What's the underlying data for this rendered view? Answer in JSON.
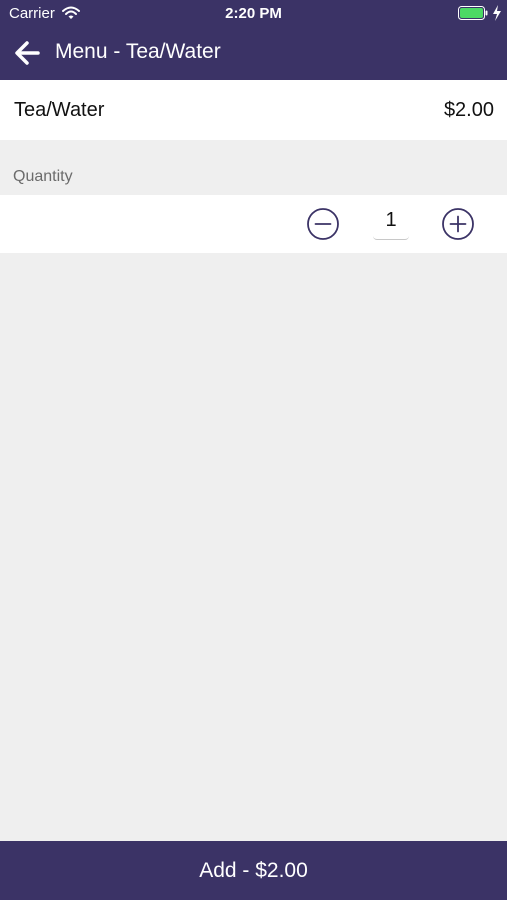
{
  "status_bar": {
    "carrier": "Carrier",
    "time": "2:20 PM"
  },
  "nav": {
    "title": "Menu - Tea/Water",
    "back_icon": "arrow-left-icon"
  },
  "item": {
    "name": "Tea/Water",
    "price": "$2.00"
  },
  "quantity": {
    "label": "Quantity",
    "value": "1",
    "decrement_icon": "minus-circle-icon",
    "increment_icon": "plus-circle-icon"
  },
  "add_button": {
    "label": "Add - $2.00"
  },
  "colors": {
    "brand": "#3b3366",
    "background": "#efefef",
    "battery": "#4cd964"
  }
}
